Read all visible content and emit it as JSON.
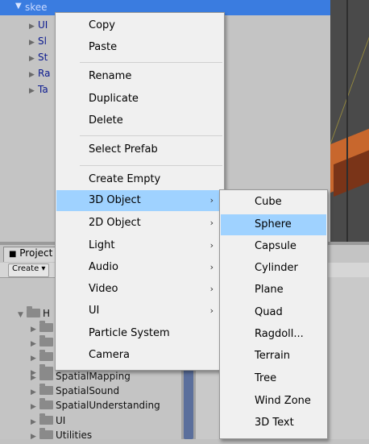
{
  "hierarchy": {
    "selected_label": "skee",
    "children": [
      "UI",
      "Sl",
      "St",
      "Ra",
      "Ta"
    ]
  },
  "project": {
    "tab_label": "Project",
    "create_label": "Create ▾",
    "folders": [
      {
        "label": "H"
      },
      {
        "label": ""
      },
      {
        "label": ""
      },
      {
        "label": ""
      },
      {
        "label": ""
      },
      {
        "label": "SpatialMapping"
      },
      {
        "label": "SpatialSound"
      },
      {
        "label": "SpatialUnderstanding"
      },
      {
        "label": "UI"
      },
      {
        "label": "Utilities"
      }
    ]
  },
  "context_menu": {
    "items": [
      "Copy",
      "Paste",
      "Rename",
      "Duplicate",
      "Delete",
      "Select Prefab",
      "Create Empty",
      "3D Object",
      "2D Object",
      "Light",
      "Audio",
      "Video",
      "UI",
      "Particle System",
      "Camera"
    ],
    "submenu_arrow": "›"
  },
  "submenu_3d": {
    "items": [
      "Cube",
      "Sphere",
      "Capsule",
      "Cylinder",
      "Plane",
      "Quad",
      "Ragdoll...",
      "Terrain",
      "Tree",
      "Wind Zone",
      "3D Text"
    ]
  },
  "colors": {
    "selection": "#3a7ce0",
    "menu_highlight": "#9fd2ff",
    "menu_bg": "#f0f0f0"
  }
}
